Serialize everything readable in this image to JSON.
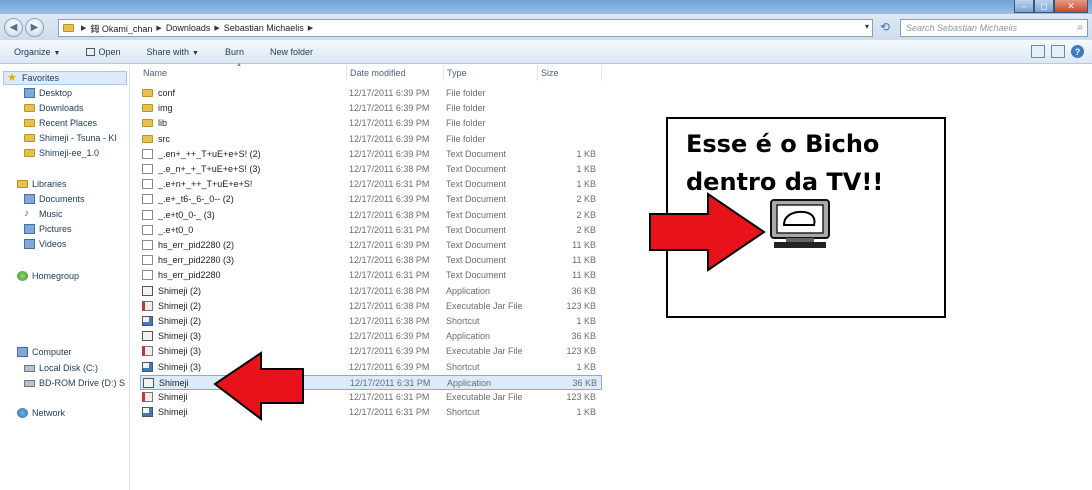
{
  "window": {
    "controls": [
      "–",
      "◻",
      "✕"
    ]
  },
  "address": {
    "crumbs": [
      "鉧 Okami_chan",
      "Downloads",
      "Sebastian Michaelis"
    ],
    "search_placeholder": "Search Sebastian Michaelis"
  },
  "toolbar": {
    "organize": "Organize",
    "open": "Open",
    "share_with": "Share with",
    "burn": "Burn",
    "new_folder": "New folder"
  },
  "nav": {
    "favorites": "Favorites",
    "favorites_items": [
      "Desktop",
      "Downloads",
      "Recent Places",
      "Shimeji - Tsuna - KI",
      "Shimeji-ee_1.0"
    ],
    "libraries": "Libraries",
    "libraries_items": [
      "Documents",
      "Music",
      "Pictures",
      "Videos"
    ],
    "homegroup": "Homegroup",
    "computer": "Computer",
    "computer_items": [
      "Local Disk (C:)",
      "BD-ROM Drive (D:) S"
    ],
    "network": "Network"
  },
  "columns": {
    "name": "Name",
    "date": "Date modified",
    "type": "Type",
    "size": "Size"
  },
  "files": [
    {
      "name": "conf",
      "date": "12/17/2011 6:39 PM",
      "type": "File folder",
      "size": "",
      "icon": "folder"
    },
    {
      "name": "img",
      "date": "12/17/2011 6:39 PM",
      "type": "File folder",
      "size": "",
      "icon": "folder"
    },
    {
      "name": "lib",
      "date": "12/17/2011 6:39 PM",
      "type": "File folder",
      "size": "",
      "icon": "folder"
    },
    {
      "name": "src",
      "date": "12/17/2011 6:39 PM",
      "type": "File folder",
      "size": "",
      "icon": "folder"
    },
    {
      "name": "_.en+_++_T+uE+e+S! (2)",
      "date": "12/17/2011 6:39 PM",
      "type": "Text Document",
      "size": "1 KB",
      "icon": "doc"
    },
    {
      "name": "_.e_n+_+_T+uE+e+S! (3)",
      "date": "12/17/2011 6:38 PM",
      "type": "Text Document",
      "size": "1 KB",
      "icon": "doc"
    },
    {
      "name": "_.e+n+_++_T+uE+e+S!",
      "date": "12/17/2011 6:31 PM",
      "type": "Text Document",
      "size": "1 KB",
      "icon": "doc"
    },
    {
      "name": "_.e+_t6-_6-_0-- (2)",
      "date": "12/17/2011 6:39 PM",
      "type": "Text Document",
      "size": "2 KB",
      "icon": "doc"
    },
    {
      "name": "_.e+t0_0-_ (3)",
      "date": "12/17/2011 6:38 PM",
      "type": "Text Document",
      "size": "2 KB",
      "icon": "doc"
    },
    {
      "name": "_.e+t0_0",
      "date": "12/17/2011 6:31 PM",
      "type": "Text Document",
      "size": "2 KB",
      "icon": "doc"
    },
    {
      "name": "hs_err_pid2280 (2)",
      "date": "12/17/2011 6:39 PM",
      "type": "Text Document",
      "size": "11 KB",
      "icon": "doc"
    },
    {
      "name": "hs_err_pid2280 (3)",
      "date": "12/17/2011 6:38 PM",
      "type": "Text Document",
      "size": "11 KB",
      "icon": "doc"
    },
    {
      "name": "hs_err_pid2280",
      "date": "12/17/2011 6:31 PM",
      "type": "Text Document",
      "size": "11 KB",
      "icon": "doc"
    },
    {
      "name": "Shimeji (2)",
      "date": "12/17/2011 6:38 PM",
      "type": "Application",
      "size": "36 KB",
      "icon": "app"
    },
    {
      "name": "Shimeji (2)",
      "date": "12/17/2011 6:38 PM",
      "type": "Executable Jar File",
      "size": "123 KB",
      "icon": "jar"
    },
    {
      "name": "Shimeji (2)",
      "date": "12/17/2011 6:38 PM",
      "type": "Shortcut",
      "size": "1 KB",
      "icon": "link"
    },
    {
      "name": "Shimeji (3)",
      "date": "12/17/2011 6:39 PM",
      "type": "Application",
      "size": "36 KB",
      "icon": "app"
    },
    {
      "name": "Shimeji (3)",
      "date": "12/17/2011 6:39 PM",
      "type": "Executable Jar File",
      "size": "123 KB",
      "icon": "jar"
    },
    {
      "name": "Shimeji (3)",
      "date": "12/17/2011 6:39 PM",
      "type": "Shortcut",
      "size": "1 KB",
      "icon": "link"
    },
    {
      "name": "Shimeji",
      "date": "12/17/2011 6:31 PM",
      "type": "Application",
      "size": "36 KB",
      "icon": "app",
      "selected": true
    },
    {
      "name": "Shimeji",
      "date": "12/17/2011 6:31 PM",
      "type": "Executable Jar File",
      "size": "123 KB",
      "icon": "jar"
    },
    {
      "name": "Shimeji",
      "date": "12/17/2011 6:31 PM",
      "type": "Shortcut",
      "size": "1 KB",
      "icon": "link"
    }
  ],
  "annotation": {
    "lines": [
      "Esse é o Bicho",
      "dentro da TV!!"
    ],
    "arrow_color": "#e8121a"
  }
}
